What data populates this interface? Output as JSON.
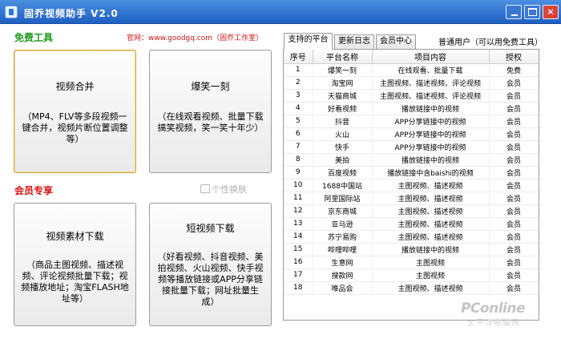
{
  "window": {
    "title": "固乔视频助手 V2.0",
    "icon": "app-icon"
  },
  "window_controls": {
    "minimize": "minimize-icon",
    "maximize": "maximize-icon",
    "close": "×"
  },
  "left_panel": {
    "free_section_title": "免费工具",
    "official_site": "官网：www.goodgq.com（固乔工作室）",
    "vip_section_title": "会员专享",
    "skin_label": "个性换肤",
    "skin_icon": "tshirt-icon",
    "buttons": [
      {
        "title": "视频合并",
        "desc": "（MP4、FLV等多段视频一键合并，视频片断位置调整等）"
      },
      {
        "title": "爆笑一刻",
        "desc": "（在线观看视频、批量下载搞笑视频，笑一笑十年少）"
      },
      {
        "title": "视频素材下载",
        "desc": "（商品主图视频、描述视频、评论视频批量下载；视频播放地址；淘宝FLASH地址等）"
      },
      {
        "title": "短视频下载",
        "desc": "（好看视频、抖音视频、美拍视频、火山视频、快手视频等播放链接或APP分享链接批量下载；网址批量生成）"
      }
    ]
  },
  "tabs": [
    {
      "label": "支持的平台",
      "active": true
    },
    {
      "label": "更新日志",
      "active": false
    },
    {
      "label": "会员中心",
      "active": false
    }
  ],
  "user_status": "普通用户（可以用免费工具）",
  "table": {
    "headers": [
      "序号",
      "平台名称",
      "项目内容",
      "授权"
    ],
    "rows": [
      [
        "1",
        "爆笑一刻",
        "在线观看、批量下载",
        "免费"
      ],
      [
        "2",
        "淘宝网",
        "主图视频、描述视频、评论视频",
        "会员"
      ],
      [
        "3",
        "天猫商城",
        "主图视频、描述视频、评论视频",
        "会员"
      ],
      [
        "4",
        "好看视频",
        "播放链接中的视频",
        "会员"
      ],
      [
        "5",
        "抖音",
        "APP分享链接中的视频",
        "会员"
      ],
      [
        "6",
        "火山",
        "APP分享链接中的视频",
        "会员"
      ],
      [
        "7",
        "快手",
        "APP分享链接中的视频",
        "会员"
      ],
      [
        "8",
        "美拍",
        "播放链接中的视频",
        "会员"
      ],
      [
        "9",
        "百度视频",
        "播放链接中含baishi的视频",
        "会员"
      ],
      [
        "10",
        "1688中国站",
        "主图视频、描述视频",
        "会员"
      ],
      [
        "11",
        "阿里国际站",
        "主图视频、描述视频",
        "会员"
      ],
      [
        "12",
        "京东商城",
        "主图视频、描述视频",
        "会员"
      ],
      [
        "13",
        "亚马逊",
        "主图视频、描述视频",
        "会员"
      ],
      [
        "14",
        "苏宁易购",
        "主图视频、描述视频",
        "会员"
      ],
      [
        "15",
        "哔哩哔哩",
        "播放链接中的视频",
        "会员"
      ],
      [
        "16",
        "生意网",
        "主图视频",
        "会员"
      ],
      [
        "17",
        "搜款网",
        "主图视频",
        "会员"
      ],
      [
        "18",
        "唯品会",
        "主图视频、描述视频",
        "会员"
      ]
    ]
  },
  "watermark": {
    "brand": "PConline",
    "sub": "太平洋电脑网"
  }
}
